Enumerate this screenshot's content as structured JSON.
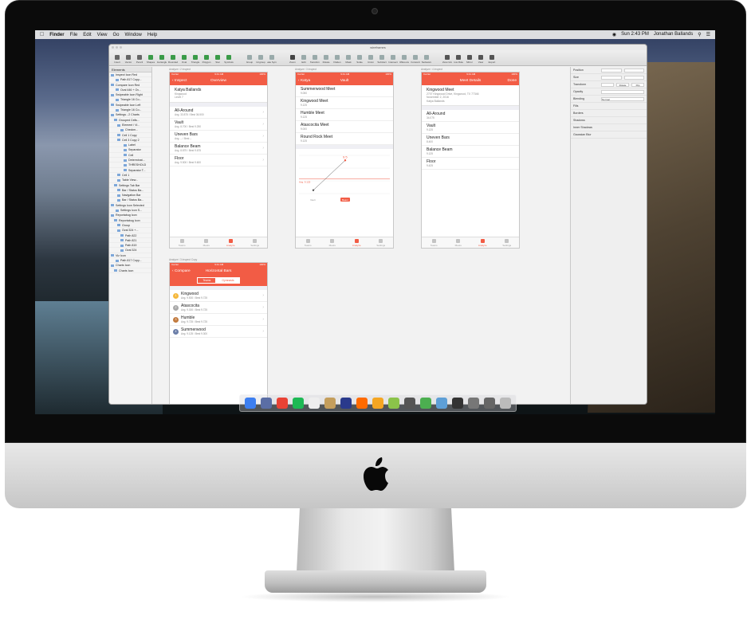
{
  "menubar": {
    "app": "Finder",
    "items": [
      "File",
      "Edit",
      "View",
      "Go",
      "Window",
      "Help"
    ],
    "clock": "Sun 2:43 PM",
    "user": "Jonathan Ballands"
  },
  "window": {
    "title": "wireframes"
  },
  "toolbar": {
    "tools": [
      "Insert",
      "Vector",
      "Pencil",
      "Shapes",
      "Rectangle",
      "Rounded",
      "Oval",
      "Triangle",
      "Polygon",
      "Star",
      "Symbols",
      "Group",
      "Ungroup",
      "Create Symbol",
      "Zoom",
      "Edit",
      "Transform",
      "Rotate",
      "Flatten",
      "Mask",
      "Scale",
      "Union",
      "Subtract",
      "Intersect",
      "Difference",
      "Forward",
      "Backward",
      "Show Grid",
      "Show Rulers",
      "Mirror",
      "View",
      "Export"
    ],
    "zoom": "100%"
  },
  "layers": {
    "header": "Elements",
    "rows": [
      "Inspect Icon Red",
      "Path 817 Copy...",
      "Compare Icon Red",
      "Oval 446 + Ov...",
      "Swipeable Icon Right",
      "Triangle 16 Co...",
      "Swipeable Icon Left",
      "Triangle 16 Co...",
      "Settings - 2 Charts",
      "Grouped Cells...",
      "Element / Vi...",
      "Checkm...",
      "Cell 1 Copy",
      "Cell 3 Copy 2",
      "Label",
      "Separator",
      "Cell",
      "Determinat...",
      "THRESHOLD",
      "Separator T...",
      "Cell 1",
      "Table View...",
      "Settings Tab Bar",
      "Bar / Status Ba...",
      "Navigation Bar",
      "Bar / Status Ba...",
      "Settings Icon Selected",
      "Settings Icon S...",
      "Reportabug Icon",
      "Reportabug Icon",
      "Group",
      "Oval 324 +...",
      "Path 822",
      "Path 821",
      "Path 819",
      "Oval 324",
      "Viz Icon",
      "Path 817 Copy...",
      "Charts Icon",
      "Charts Icon"
    ]
  },
  "inspector": {
    "rows": [
      "Position",
      "Size",
      "Transform",
      "Opacity",
      "Blending",
      "Fills",
      "Borders",
      "Shadows",
      "Inner Shadows",
      "Gaussian Blur"
    ],
    "blending_value": "Normal",
    "transform_buttons": [
      "Rotate",
      "Flip"
    ]
  },
  "artboards": {
    "overview": {
      "label": "Analyze / 2 Inspect",
      "carrier": "Carrier",
      "time": "9:41 AM",
      "battery": "100%",
      "back": "Inspect",
      "title": "Overview",
      "name": "Katya Ballands",
      "sub1": "Kingwood",
      "sub2": "Level 7",
      "cells": [
        {
          "title": "All-Around",
          "sub": "Avg. 33.875 / Best 36.500"
        },
        {
          "title": "Vault",
          "sub": "Avg. 8.700 / Best 9.250"
        },
        {
          "title": "Uneven Bars",
          "sub": "Avg. -- / Best --"
        },
        {
          "title": "Balance Beam",
          "sub": "Avg. 8.875 / Best 9.675"
        },
        {
          "title": "Floor",
          "sub": "Avg. 9.500 / Best 9.600"
        }
      ]
    },
    "vault": {
      "label": "Analyze / 3 Inspect",
      "back": "Katya",
      "title": "Vault",
      "meets": [
        {
          "title": "Summerwood Meet",
          "sub": "9.050"
        },
        {
          "title": "Kingwood Meet",
          "sub": "9.125"
        },
        {
          "title": "Humble Meet",
          "sub": "9.125"
        },
        {
          "title": "Atascocita Meet",
          "sub": "9.000"
        },
        {
          "title": "Round Rock Meet",
          "sub": "9.125"
        }
      ],
      "chart_data": {
        "type": "line",
        "points": [
          {
            "label": "",
            "value": 8.9
          },
          {
            "label": "9.5",
            "value": 9.5
          }
        ],
        "avg_line_label": "Avg. 9.125",
        "x_labels": [
          "Vault",
          "Beam"
        ]
      }
    },
    "meet": {
      "label": "Analyze / 4 Inspect",
      "carrier": "Carrier",
      "title": "Meet Details",
      "done": "Done",
      "name": "Kingwood Meet",
      "address": "2707 Kingwood Drive, Kingwood, TX 77346",
      "date": "November 2, 2016",
      "athlete": "Katya Ballands",
      "cells": [
        {
          "title": "All-Around",
          "sub": "34.075"
        },
        {
          "title": "Vault",
          "sub": "9.125"
        },
        {
          "title": "Uneven Bars",
          "sub": "8.400"
        },
        {
          "title": "Balance Beam",
          "sub": "9.125"
        },
        {
          "title": "Floor",
          "sub": "9.425"
        }
      ]
    },
    "compare": {
      "label": "Analyze / 3 Inspect Copy",
      "back": "Compare",
      "title": "Horizontal Bars",
      "segments": [
        "Teams",
        "Gymnasts"
      ],
      "rows": [
        {
          "rank": "1",
          "title": "Kingwood",
          "sub": "Avg. 9.500 / Best 9.725",
          "color": "#f5b83d"
        },
        {
          "rank": "2",
          "title": "Atascocita",
          "sub": "Avg. 9.300 / Best 9.725",
          "color": "#a9a9a9"
        },
        {
          "rank": "3",
          "title": "Humble",
          "sub": "Avg. 9.725 / Best 9.725",
          "color": "#c27a3e"
        },
        {
          "rank": "4",
          "title": "Summerwood",
          "sub": "Avg. 9.125 / Best 9.300",
          "color": "#6b7ea8"
        }
      ]
    },
    "tabs": [
      "Teams",
      "Meets",
      "Analyze",
      "Settings"
    ]
  },
  "colors": {
    "accent": "#f25c45"
  }
}
